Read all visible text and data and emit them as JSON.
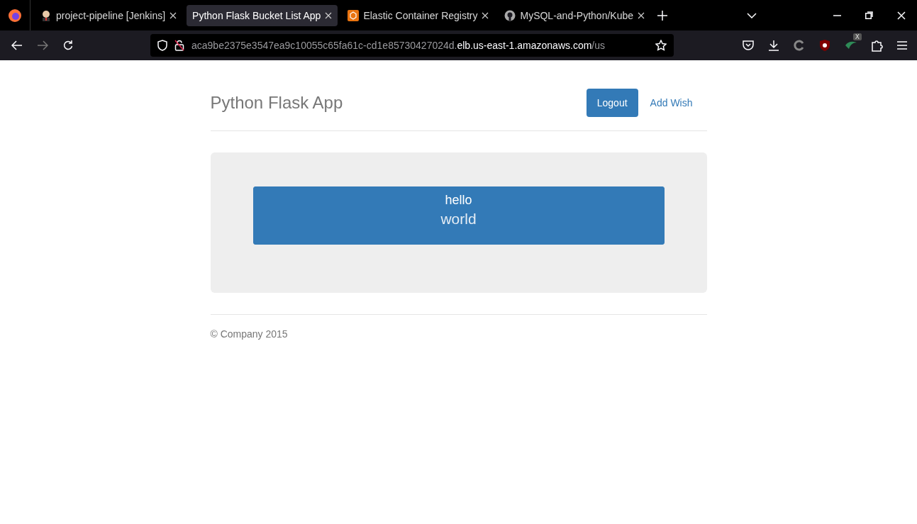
{
  "browser": {
    "tabs": [
      {
        "title": "project-pipeline [Jenkins]",
        "selected": false
      },
      {
        "title": "Python Flask Bucket List App",
        "selected": true
      },
      {
        "title": "Elastic Container Registry",
        "selected": false
      },
      {
        "title": "MySQL-and-Python/Kube",
        "selected": false
      }
    ],
    "url": {
      "host_prefix": "aca9be2375e3547ea9c10055c65fa61c-cd1e85730427024d.",
      "domain": "elb.us-east-1.amazonaws.com",
      "path": "/us"
    },
    "extension_badge": "X"
  },
  "app": {
    "brand": "Python Flask App",
    "nav": [
      {
        "label": "Logout",
        "kind": "button"
      },
      {
        "label": "Add Wish",
        "kind": "link"
      }
    ],
    "wishes": [
      {
        "title": "hello",
        "description": "world"
      }
    ],
    "footer": "© Company 2015"
  }
}
